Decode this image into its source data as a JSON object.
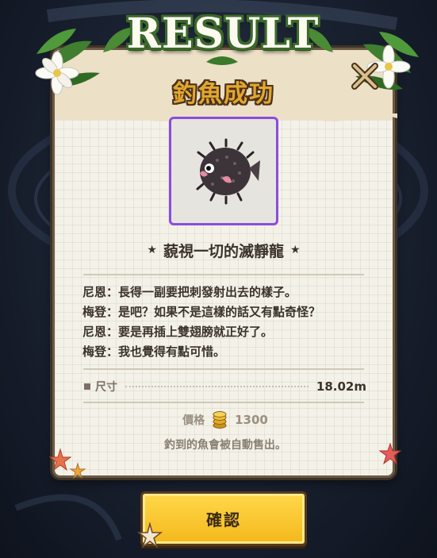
{
  "header": {
    "title": "RESULT",
    "subtitle": "釣魚成功"
  },
  "catch": {
    "fish_name": "藐視一切的滅靜龍",
    "fish_icon": "pufferfish-icon",
    "frame_color": "#8a4ce0",
    "dialogue": [
      "尼恩：長得一副要把刺發射出去的樣子。",
      "梅登：是吧？如果不是這樣的話又有點奇怪？",
      "尼恩：要是再插上雙翅膀就正好了。",
      "梅登：我也覺得有點可惜。"
    ],
    "size_label": "尺寸",
    "size_value": "18.02m",
    "price_label": "價格",
    "price_value": "1300",
    "auto_sold_note": "釣到的魚會被自動售出。"
  },
  "buttons": {
    "confirm_label": "確認",
    "close_icon": "close-icon"
  },
  "colors": {
    "title_green": "#3b6a2b",
    "subtitle_gold": "#e3a72e",
    "confirm_yellow": "#ffd84a"
  }
}
